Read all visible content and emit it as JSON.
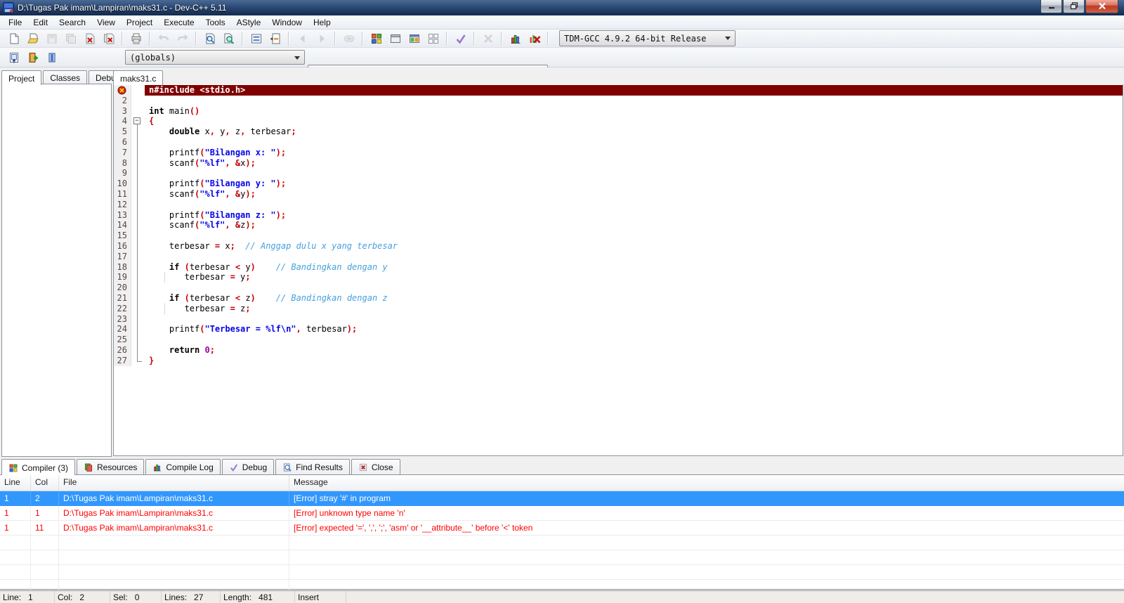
{
  "window": {
    "title": "D:\\Tugas Pak imam\\Lampiran\\maks31.c - Dev-C++ 5.11"
  },
  "menu": [
    "File",
    "Edit",
    "Search",
    "View",
    "Project",
    "Execute",
    "Tools",
    "AStyle",
    "Window",
    "Help"
  ],
  "toolbar1": {
    "groups": [
      [
        {
          "name": "new-file"
        },
        {
          "name": "open-file"
        },
        {
          "name": "save",
          "disabled": true
        },
        {
          "name": "save-all",
          "disabled": true
        },
        {
          "name": "close-file"
        },
        {
          "name": "close-all-files"
        }
      ],
      [
        {
          "name": "print"
        }
      ],
      [
        {
          "name": "undo",
          "disabled": true
        },
        {
          "name": "redo",
          "disabled": true
        }
      ],
      [
        {
          "name": "find"
        },
        {
          "name": "find-in-files"
        }
      ],
      [
        {
          "name": "replace"
        },
        {
          "name": "goto-line"
        }
      ],
      [
        {
          "name": "back",
          "disabled": true
        },
        {
          "name": "forward",
          "disabled": true
        }
      ],
      [
        {
          "name": "options-ellipsis",
          "disabled": true
        }
      ],
      [
        {
          "name": "compile"
        },
        {
          "name": "run"
        },
        {
          "name": "compile-and-run"
        },
        {
          "name": "rebuild-all"
        }
      ],
      [
        {
          "name": "syntax-check"
        }
      ],
      [
        {
          "name": "abort",
          "disabled": true
        }
      ],
      [
        {
          "name": "profile-analysis"
        },
        {
          "name": "delete-profiling"
        }
      ]
    ],
    "compiler_combo": "TDM-GCC 4.9.2 64-bit Release"
  },
  "toolbar2": {
    "icons": [
      {
        "name": "insert-snippet"
      },
      {
        "name": "toggle-bookmark"
      },
      {
        "name": "goto-bookmark"
      }
    ],
    "globals_combo": "(globals)",
    "members_combo": ""
  },
  "left_tabs": [
    {
      "key": "project",
      "label": "Project",
      "active": true
    },
    {
      "key": "classes",
      "label": "Classes"
    },
    {
      "key": "debug",
      "label": "Debug"
    }
  ],
  "editor": {
    "tab": "maks31.c",
    "lines": [
      {
        "n": 1,
        "error": true,
        "tokens": [
          [
            "n#include <stdio.h>",
            ""
          ]
        ]
      },
      {
        "n": 2,
        "tokens": []
      },
      {
        "n": 3,
        "tokens": [
          [
            "int",
            "k"
          ],
          [
            " main",
            ""
          ],
          [
            "()",
            "p"
          ]
        ]
      },
      {
        "n": 4,
        "fold": "start",
        "tokens": [
          [
            "{",
            "p"
          ]
        ]
      },
      {
        "n": 5,
        "fold": "mid",
        "tokens": [
          [
            "    ",
            ""
          ],
          [
            "double",
            "k"
          ],
          [
            " x",
            ""
          ],
          [
            ",",
            "p"
          ],
          [
            " y",
            ""
          ],
          [
            ",",
            "p"
          ],
          [
            " z",
            ""
          ],
          [
            ",",
            "p"
          ],
          [
            " terbesar",
            ""
          ],
          [
            ";",
            "p"
          ]
        ]
      },
      {
        "n": 6,
        "fold": "mid",
        "tokens": []
      },
      {
        "n": 7,
        "fold": "mid",
        "tokens": [
          [
            "    printf",
            ""
          ],
          [
            "(",
            "p"
          ],
          [
            "\"Bilangan x: \"",
            "s"
          ],
          [
            ")",
            "p"
          ],
          [
            ";",
            "p"
          ]
        ]
      },
      {
        "n": 8,
        "fold": "mid",
        "tokens": [
          [
            "    scanf",
            ""
          ],
          [
            "(",
            "p"
          ],
          [
            "\"%lf\"",
            "s"
          ],
          [
            ",",
            "p"
          ],
          [
            " ",
            ""
          ],
          [
            "&",
            "p"
          ],
          [
            "x",
            ""
          ],
          [
            ")",
            "p"
          ],
          [
            ";",
            "p"
          ]
        ]
      },
      {
        "n": 9,
        "fold": "mid",
        "tokens": []
      },
      {
        "n": 10,
        "fold": "mid",
        "tokens": [
          [
            "    printf",
            ""
          ],
          [
            "(",
            "p"
          ],
          [
            "\"Bilangan y: \"",
            "s"
          ],
          [
            ")",
            "p"
          ],
          [
            ";",
            "p"
          ]
        ]
      },
      {
        "n": 11,
        "fold": "mid",
        "tokens": [
          [
            "    scanf",
            ""
          ],
          [
            "(",
            "p"
          ],
          [
            "\"%lf\"",
            "s"
          ],
          [
            ",",
            "p"
          ],
          [
            " ",
            ""
          ],
          [
            "&",
            "p"
          ],
          [
            "y",
            ""
          ],
          [
            ")",
            "p"
          ],
          [
            ";",
            "p"
          ]
        ]
      },
      {
        "n": 12,
        "fold": "mid",
        "tokens": []
      },
      {
        "n": 13,
        "fold": "mid",
        "tokens": [
          [
            "    printf",
            ""
          ],
          [
            "(",
            "p"
          ],
          [
            "\"Bilangan z: \"",
            "s"
          ],
          [
            ")",
            "p"
          ],
          [
            ";",
            "p"
          ]
        ]
      },
      {
        "n": 14,
        "fold": "mid",
        "tokens": [
          [
            "    scanf",
            ""
          ],
          [
            "(",
            "p"
          ],
          [
            "\"%lf\"",
            "s"
          ],
          [
            ",",
            "p"
          ],
          [
            " ",
            ""
          ],
          [
            "&",
            "p"
          ],
          [
            "z",
            ""
          ],
          [
            ")",
            "p"
          ],
          [
            ";",
            "p"
          ]
        ]
      },
      {
        "n": 15,
        "fold": "mid",
        "tokens": []
      },
      {
        "n": 16,
        "fold": "mid",
        "tokens": [
          [
            "    terbesar ",
            ""
          ],
          [
            "=",
            "p"
          ],
          [
            " x",
            ""
          ],
          [
            ";",
            "p"
          ],
          [
            "  ",
            ""
          ],
          [
            "// Anggap dulu x yang terbesar",
            "c"
          ]
        ]
      },
      {
        "n": 17,
        "fold": "mid",
        "tokens": []
      },
      {
        "n": 18,
        "fold": "mid",
        "tokens": [
          [
            "    ",
            ""
          ],
          [
            "if",
            "k"
          ],
          [
            " ",
            ""
          ],
          [
            "(",
            "p"
          ],
          [
            "terbesar ",
            ""
          ],
          [
            "<",
            "p"
          ],
          [
            " y",
            ""
          ],
          [
            ")",
            "p"
          ],
          [
            "    ",
            ""
          ],
          [
            "// Bandingkan dengan y",
            "c"
          ]
        ]
      },
      {
        "n": 19,
        "fold": "mid",
        "guide": true,
        "tokens": [
          [
            "       terbesar ",
            ""
          ],
          [
            "=",
            "p"
          ],
          [
            " y",
            ""
          ],
          [
            ";",
            "p"
          ]
        ]
      },
      {
        "n": 20,
        "fold": "mid",
        "tokens": []
      },
      {
        "n": 21,
        "fold": "mid",
        "tokens": [
          [
            "    ",
            ""
          ],
          [
            "if",
            "k"
          ],
          [
            " ",
            ""
          ],
          [
            "(",
            "p"
          ],
          [
            "terbesar ",
            ""
          ],
          [
            "<",
            "p"
          ],
          [
            " z",
            ""
          ],
          [
            ")",
            "p"
          ],
          [
            "    ",
            ""
          ],
          [
            "// Bandingkan dengan z",
            "c"
          ]
        ]
      },
      {
        "n": 22,
        "fold": "mid",
        "guide": true,
        "tokens": [
          [
            "       terbesar ",
            ""
          ],
          [
            "=",
            "p"
          ],
          [
            " z",
            ""
          ],
          [
            ";",
            "p"
          ]
        ]
      },
      {
        "n": 23,
        "fold": "mid",
        "tokens": []
      },
      {
        "n": 24,
        "fold": "mid",
        "tokens": [
          [
            "    printf",
            ""
          ],
          [
            "(",
            "p"
          ],
          [
            "\"Terbesar = %lf\\n\"",
            "s"
          ],
          [
            ",",
            "p"
          ],
          [
            " terbesar",
            ""
          ],
          [
            ")",
            "p"
          ],
          [
            ";",
            "p"
          ]
        ]
      },
      {
        "n": 25,
        "fold": "mid",
        "tokens": []
      },
      {
        "n": 26,
        "fold": "mid",
        "tokens": [
          [
            "    ",
            ""
          ],
          [
            "return",
            "k"
          ],
          [
            " ",
            ""
          ],
          [
            "0",
            "n"
          ],
          [
            ";",
            "p"
          ]
        ]
      },
      {
        "n": 27,
        "fold": "end",
        "tokens": [
          [
            "}",
            "p"
          ]
        ]
      }
    ]
  },
  "bottom_tabs": [
    {
      "key": "compiler",
      "label": "Compiler (3)",
      "icon": "compiler-icon",
      "active": true
    },
    {
      "key": "resources",
      "label": "Resources",
      "icon": "resources-icon"
    },
    {
      "key": "compile-log",
      "label": "Compile Log",
      "icon": "compile-log-icon"
    },
    {
      "key": "debug",
      "label": "Debug",
      "icon": "debug-icon"
    },
    {
      "key": "find-results",
      "label": "Find Results",
      "icon": "find-results-icon"
    },
    {
      "key": "close",
      "label": "Close",
      "icon": "close-icon"
    }
  ],
  "grid": {
    "headers": [
      "Line",
      "Col",
      "File",
      "Message"
    ],
    "rows": [
      {
        "line": "1",
        "col": "2",
        "file": "D:\\Tugas Pak imam\\Lampiran\\maks31.c",
        "message": "[Error] stray '#' in program",
        "state": "selected"
      },
      {
        "line": "1",
        "col": "1",
        "file": "D:\\Tugas Pak imam\\Lampiran\\maks31.c",
        "message": "[Error] unknown type name 'n'",
        "state": "error"
      },
      {
        "line": "1",
        "col": "11",
        "file": "D:\\Tugas Pak imam\\Lampiran\\maks31.c",
        "message": "[Error] expected '=', ',', ';', 'asm' or '__attribute__' before '<' token",
        "state": "error"
      }
    ],
    "empty_rows": 4
  },
  "status": {
    "panels": [
      {
        "key": "line",
        "label": "Line:",
        "value": "1"
      },
      {
        "key": "col",
        "label": "Col:",
        "value": "2"
      },
      {
        "key": "sel",
        "label": "Sel:",
        "value": "0"
      },
      {
        "key": "lines",
        "label": "Lines:",
        "value": "27"
      },
      {
        "key": "length",
        "label": "Length:",
        "value": "481"
      },
      {
        "key": "mode",
        "label": "Insert",
        "value": ""
      }
    ]
  },
  "colors": {
    "selection_blue": "#3297fd",
    "error_red": "#ff0000",
    "error_line_bg": "#800000",
    "string_blue": "#0404e8",
    "comment_blue": "#47a1dd",
    "symbol_red": "#c80000"
  }
}
